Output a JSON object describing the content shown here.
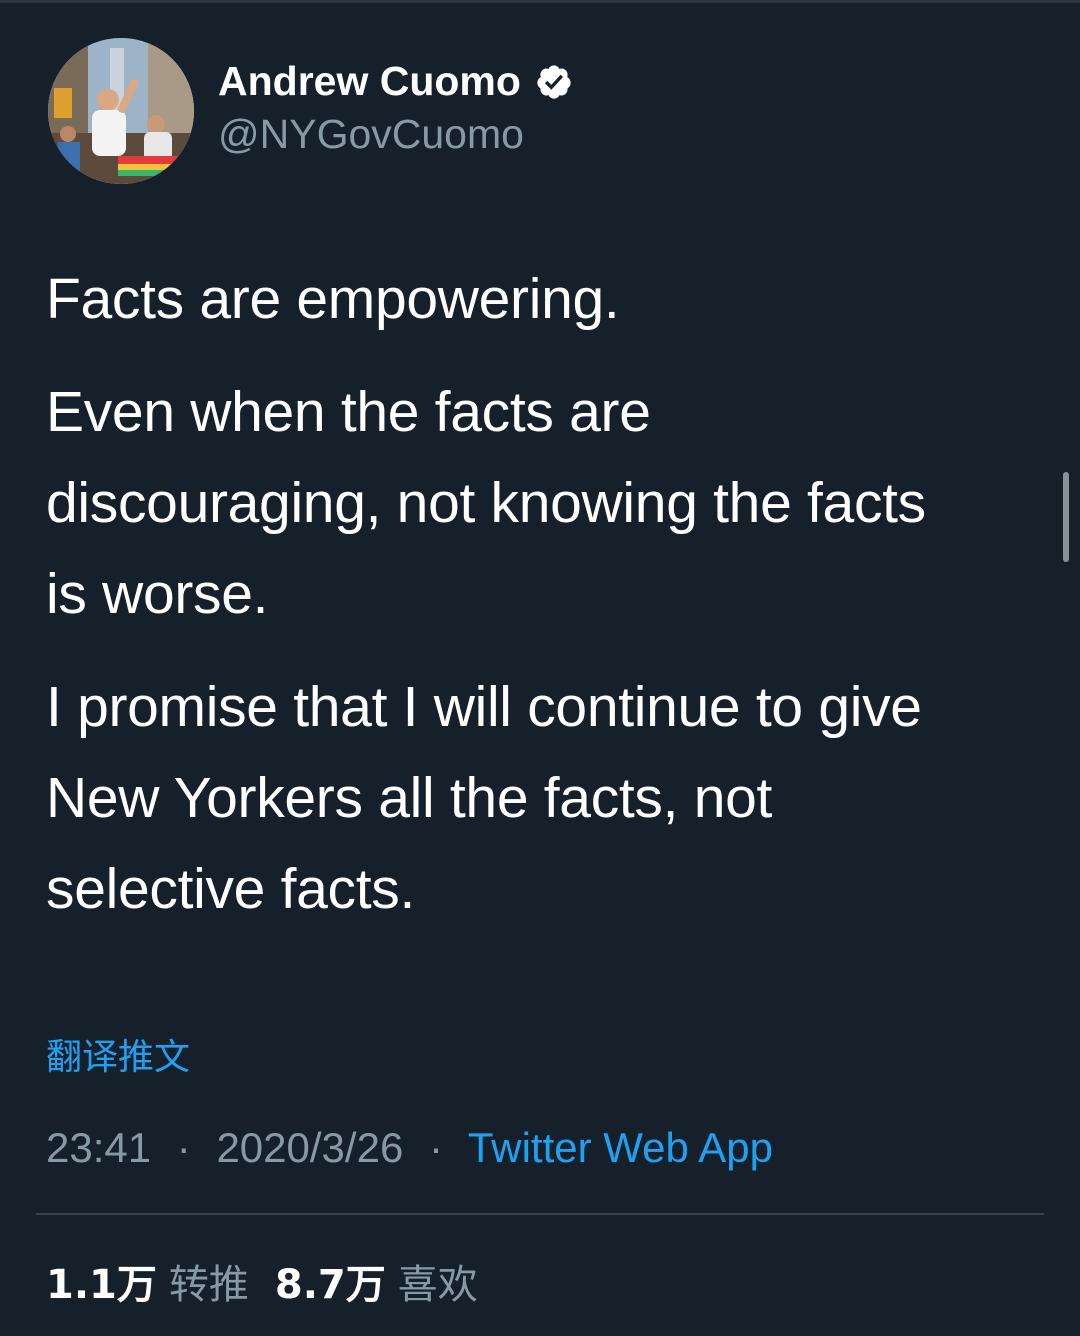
{
  "author": {
    "display_name": "Andrew Cuomo",
    "handle": "@NYGovCuomo",
    "verified": true
  },
  "tweet": {
    "paragraphs": [
      "Facts are empowering.",
      "Even when the facts are\ndiscouraging, not knowing the facts\nis worse.",
      "I promise that I will continue to give\nNew Yorkers all the facts, not\nselective facts."
    ]
  },
  "translate_label": "翻译推文",
  "meta": {
    "time": "23:41",
    "separator": "·",
    "date": "2020/3/26",
    "source": "Twitter Web App"
  },
  "stats": {
    "retweets_count": "1.1万",
    "retweets_label": "转推",
    "likes_count": "8.7万",
    "likes_label": "喜欢"
  },
  "colors": {
    "background": "#15202b",
    "text": "#ffffff",
    "secondary": "#8899a6",
    "link": "#1da1f2",
    "divider": "#38444d"
  },
  "icons": {
    "verified": "verified-badge-icon"
  }
}
